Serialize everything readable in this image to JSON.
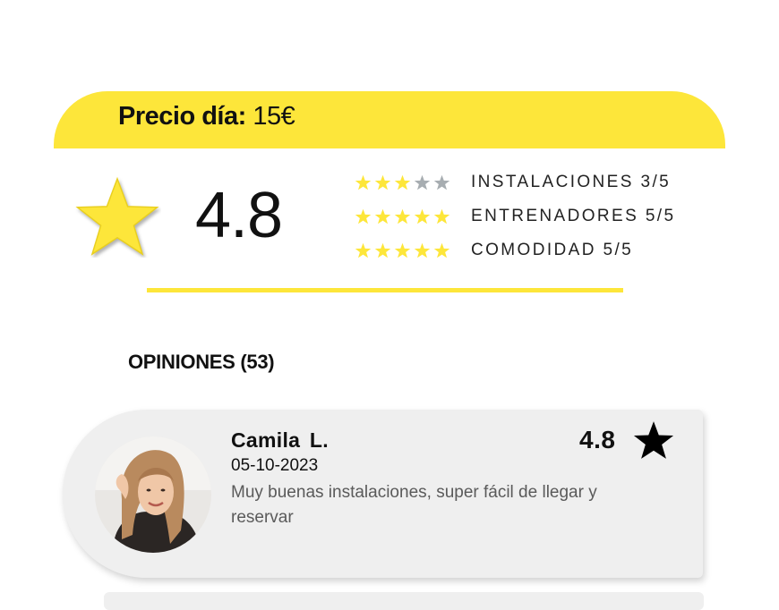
{
  "price": {
    "label": "Precio día:",
    "value": "15€"
  },
  "overall": {
    "score": "4.8"
  },
  "ratings": [
    {
      "label": "INSTALACIONES 3/5",
      "stars": 3,
      "max": 5
    },
    {
      "label": "ENTRENADORES 5/5",
      "stars": 5,
      "max": 5
    },
    {
      "label": "COMODIDAD 5/5",
      "stars": 5,
      "max": 5
    }
  ],
  "opinions": {
    "title": "OPINIONES (53)"
  },
  "reviews": [
    {
      "name": "Camila  L.",
      "date": "05-10-2023",
      "score": "4.8",
      "text": "Muy buenas instalaciones, super fácil de llegar y reservar"
    }
  ],
  "colors": {
    "accent": "#fde63a",
    "card": "#efefef",
    "star_empty": "#a7adb1"
  },
  "icons": {
    "overall": "star-icon",
    "review": "star-icon"
  }
}
